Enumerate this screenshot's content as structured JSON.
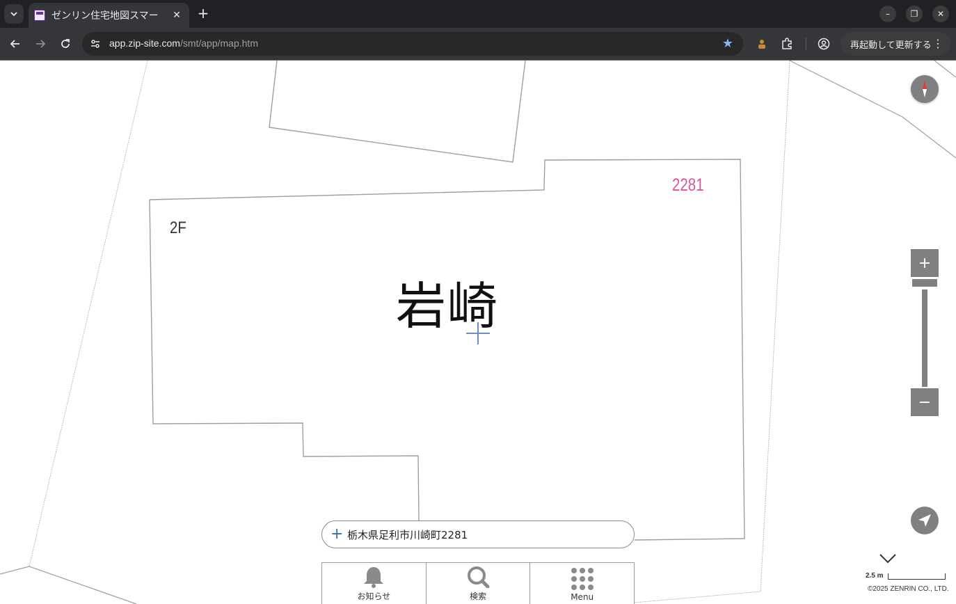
{
  "browser": {
    "tab_title": "ゼンリン住宅地図スマー",
    "url_host": "app.zip-site.com",
    "url_path": "/smt/app/map.htm",
    "update_button_label": "再起動して更新する"
  },
  "map": {
    "lot_number": "2281",
    "floor_label": "2F",
    "building_name": "岩崎",
    "address": "栃木県足利市川崎町2281",
    "scale_label": "2.5 m",
    "copyright": "©2025 ZENRIN CO., LTD."
  },
  "bottom_menu": {
    "items": [
      {
        "label": "お知らせ",
        "icon": "bell-icon"
      },
      {
        "label": "検索",
        "icon": "search-icon"
      },
      {
        "label": "Menu",
        "icon": "grid-menu-icon"
      }
    ]
  },
  "colors": {
    "lot_number": "#e0529a",
    "controls": "#808080",
    "crosshair": "#6a8fc0"
  }
}
